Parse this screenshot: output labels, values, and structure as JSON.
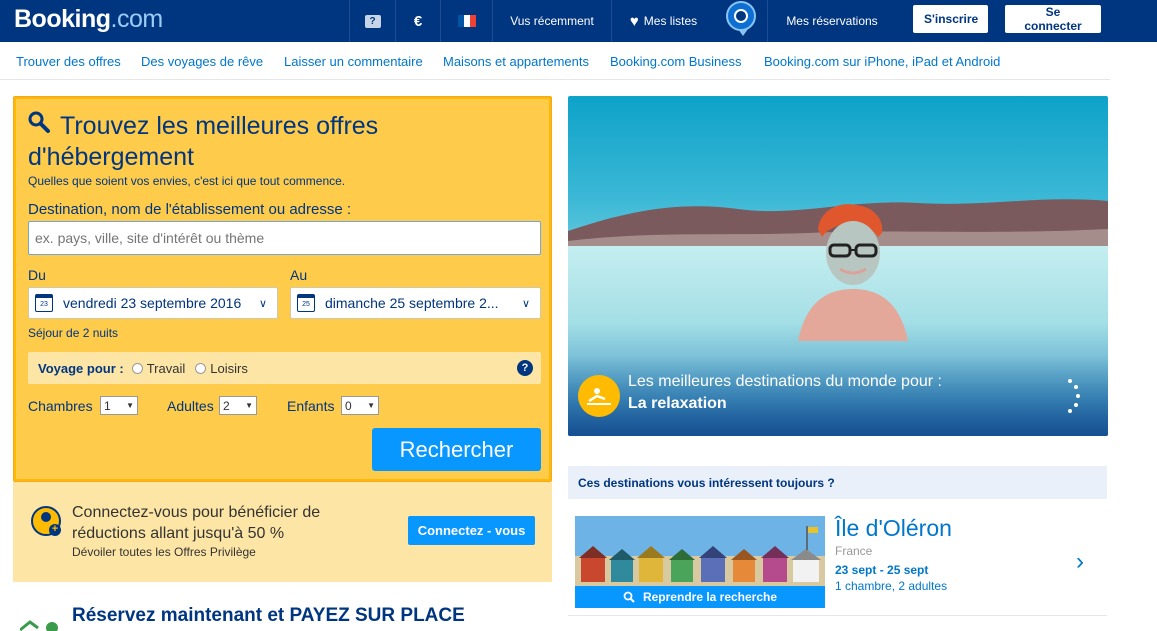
{
  "header": {
    "logo_main": "Booking",
    "logo_dot": ".",
    "logo_com": "com",
    "help_icon": "help-icon",
    "currency": "€",
    "flag_colors": [
      "#0055a4",
      "#ffffff",
      "#ef4135"
    ],
    "recently_viewed": "Vus récemment",
    "wishlists": "Mes listes",
    "reservations": "Mes réservations",
    "signup": "S'inscrire",
    "signin": "Se connecter"
  },
  "subnav": [
    "Trouver des offres",
    "Des voyages de rêve",
    "Laisser un commentaire",
    "Maisons et appartements",
    "Booking.com Business",
    "Booking.com sur iPhone, iPad et Android"
  ],
  "search": {
    "title": "Trouvez les meilleures offres d'hébergement",
    "subtitle": "Quelles que soient vos envies, c'est ici que tout commence.",
    "destination_label": "Destination, nom de l'établissement ou adresse :",
    "destination_placeholder": "ex. pays, ville, site d'intérêt ou thème",
    "checkin_label": "Du",
    "checkout_label": "Au",
    "checkin_day": "23",
    "checkin_value": "vendredi 23 septembre 2016",
    "checkout_day": "25",
    "checkout_value": "dimanche 25 septembre 2...",
    "nights": "Séjour de 2 nuits",
    "trip_label": "Voyage pour :",
    "trip_work": "Travail",
    "trip_leisure": "Loisirs",
    "rooms_label": "Chambres",
    "rooms_value": "1",
    "adults_label": "Adultes",
    "adults_value": "2",
    "children_label": "Enfants",
    "children_value": "0",
    "submit": "Rechercher"
  },
  "connect": {
    "text": "Connectez-vous pour bénéficier de réductions allant jusqu'à 50 %",
    "subtext": "Dévoiler toutes les Offres Privilège",
    "button": "Connectez - vous"
  },
  "pay_now": "Réservez maintenant et PAYEZ SUR PLACE",
  "hero": {
    "line1": "Les meilleures destinations du monde pour :",
    "line2": "La relaxation"
  },
  "recent": {
    "heading": "Ces destinations vous intéressent toujours ?",
    "destination": "Île d'Oléron",
    "country": "France",
    "dates": "23 sept - 25 sept",
    "rooms": "1 chambre, 2 adultes",
    "resume": "Reprendre la recherche"
  },
  "colors": {
    "brand_blue": "#003580",
    "accent_yellow": "#febb02",
    "button_blue": "#0896ff",
    "link_blue": "#0077cc"
  }
}
